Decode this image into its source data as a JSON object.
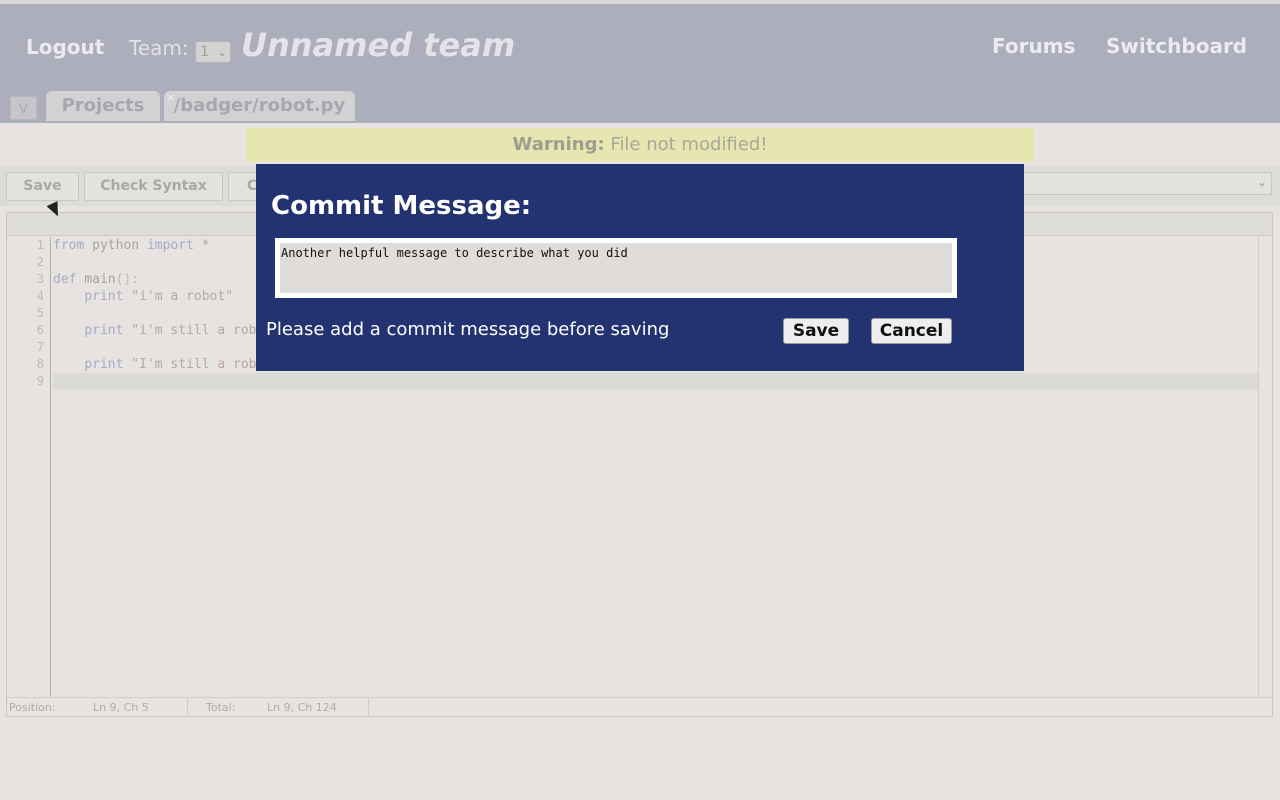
{
  "header": {
    "logout": "Logout",
    "team_label": "Team:",
    "team_select_value": "1",
    "team_name": "Unnamed team",
    "nav": [
      "Forums",
      "Switchboard"
    ]
  },
  "tabs": {
    "toggle": "v",
    "items": [
      "Projects",
      "/badger/robot.py"
    ],
    "close": "×"
  },
  "warning": {
    "label": "Warning:",
    "text": "File not modified!"
  },
  "toolbar": {
    "buttons": [
      "Save",
      "Check Syntax",
      "C"
    ]
  },
  "editor": {
    "line_numbers": [
      "1",
      "2",
      "3",
      "4",
      "5",
      "6",
      "7",
      "8",
      "9"
    ],
    "status": {
      "position_label": "Position:",
      "position_value": "Ln 9, Ch 5",
      "total_label": "Total:",
      "total_value": "Ln 9, Ch 124"
    }
  },
  "modal": {
    "title": "Commit Message:",
    "commit_value": "Another helpful message to describe what you did",
    "hint": "Please add a commit message before saving",
    "save": "Save",
    "cancel": "Cancel"
  },
  "colors": {
    "modal_bg": "#233270",
    "header_bg": "#adaebb",
    "warning_bg": "#e8e6b0"
  }
}
